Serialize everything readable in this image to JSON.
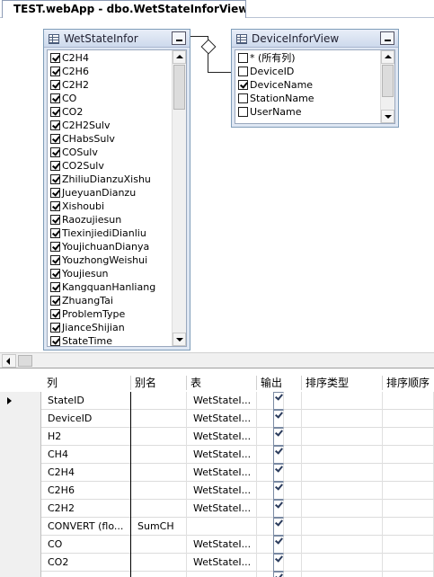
{
  "tab": {
    "title": "TEST.webApp - dbo.WetStateInforView*"
  },
  "left_table": {
    "name": "WetStateInfor",
    "columns": [
      {
        "label": "C2H4",
        "checked": true
      },
      {
        "label": "C2H6",
        "checked": true
      },
      {
        "label": "C2H2",
        "checked": true
      },
      {
        "label": "CO",
        "checked": true
      },
      {
        "label": "CO2",
        "checked": true
      },
      {
        "label": "C2H2Sulv",
        "checked": true
      },
      {
        "label": "CHabsSulv",
        "checked": true
      },
      {
        "label": "COSulv",
        "checked": true
      },
      {
        "label": "CO2Sulv",
        "checked": true
      },
      {
        "label": "ZhiliuDianzuXishu",
        "checked": true
      },
      {
        "label": "JueyuanDianzu",
        "checked": true
      },
      {
        "label": "Xishoubi",
        "checked": true
      },
      {
        "label": "Raozujiesun",
        "checked": true
      },
      {
        "label": "TiexinjiediDianliu",
        "checked": true
      },
      {
        "label": "YoujichuanDianya",
        "checked": true
      },
      {
        "label": "YouzhongWeishui",
        "checked": true
      },
      {
        "label": "Youjiesun",
        "checked": true
      },
      {
        "label": "KangquanHanliang",
        "checked": true
      },
      {
        "label": "ZhuangTai",
        "checked": true
      },
      {
        "label": "ProblemType",
        "checked": true
      },
      {
        "label": "JianceShijian",
        "checked": true
      },
      {
        "label": "StateTime",
        "checked": true
      }
    ]
  },
  "right_table": {
    "name": "DeviceInforView",
    "columns": [
      {
        "label": "* (所有列)",
        "checked": false
      },
      {
        "label": "DeviceID",
        "checked": false
      },
      {
        "label": "DeviceName",
        "checked": true
      },
      {
        "label": "StationName",
        "checked": false
      },
      {
        "label": "UserName",
        "checked": false
      }
    ]
  },
  "grid": {
    "headers": [
      "列",
      "别名",
      "表",
      "输出",
      "排序类型",
      "排序顺序"
    ],
    "rows": [
      {
        "column": "StateID",
        "alias": "",
        "table": "WetStateI...",
        "output": true,
        "current": true
      },
      {
        "column": "DeviceID",
        "alias": "",
        "table": "WetStateI...",
        "output": true,
        "current": false
      },
      {
        "column": "H2",
        "alias": "",
        "table": "WetStateI...",
        "output": true,
        "current": false
      },
      {
        "column": "CH4",
        "alias": "",
        "table": "WetStateI...",
        "output": true,
        "current": false
      },
      {
        "column": "C2H4",
        "alias": "",
        "table": "WetStateI...",
        "output": true,
        "current": false
      },
      {
        "column": "C2H6",
        "alias": "",
        "table": "WetStateI...",
        "output": true,
        "current": false
      },
      {
        "column": "C2H2",
        "alias": "",
        "table": "WetStateI...",
        "output": true,
        "current": false
      },
      {
        "column": "CONVERT (flo...",
        "alias": "SumCH",
        "table": "",
        "output": true,
        "current": false
      },
      {
        "column": "CO",
        "alias": "",
        "table": "WetStateI...",
        "output": true,
        "current": false
      },
      {
        "column": "CO2",
        "alias": "",
        "table": "WetStateI...",
        "output": true,
        "current": false
      },
      {
        "column": "",
        "alias": "",
        "table": "",
        "output": true,
        "current": false
      }
    ]
  }
}
